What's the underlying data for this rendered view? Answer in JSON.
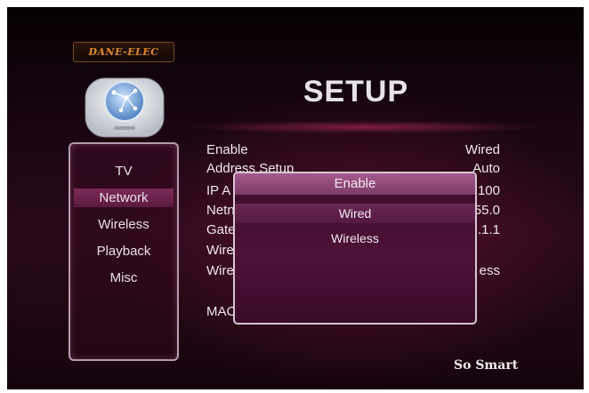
{
  "brand": {
    "logo_text": "DANE-ELEC",
    "tagline": "So Smart"
  },
  "title": "SETUP",
  "sidebar": {
    "items": [
      {
        "label": "TV"
      },
      {
        "label": "Network",
        "active": true
      },
      {
        "label": "Wireless"
      },
      {
        "label": "Playback"
      },
      {
        "label": "Misc"
      }
    ]
  },
  "settings": {
    "rows": [
      {
        "label": "Enable",
        "value": "Wired"
      },
      {
        "label": "Address Setup",
        "value": "Auto"
      },
      {
        "label": "IP A",
        "value": ".100"
      },
      {
        "label": "Netn",
        "value": "55.0"
      },
      {
        "label": "Gate",
        "value": ".1.1"
      },
      {
        "label": "Wire",
        "value": ""
      },
      {
        "label": "Wire",
        "value": "ess"
      },
      {
        "label": "MAC",
        "value": ""
      }
    ]
  },
  "popup": {
    "title": "Enable",
    "options": [
      {
        "label": "Wired",
        "selected": true
      },
      {
        "label": "Wireless",
        "selected": false
      }
    ]
  },
  "colors": {
    "background": "#1b0612",
    "accent": "#7d2a5a",
    "logo": "#e48a2c"
  },
  "icons": {
    "device": "media-player-icon"
  }
}
